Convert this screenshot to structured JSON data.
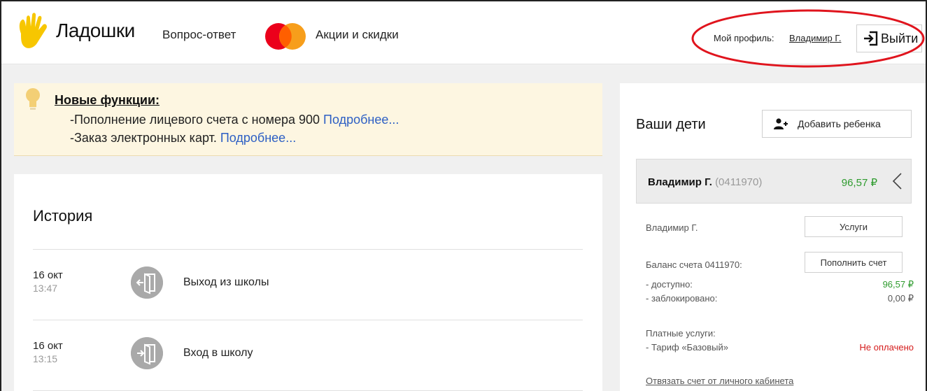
{
  "header": {
    "brand": "Ладошки",
    "nav_faq": "Вопрос-ответ",
    "nav_promo": "Акции и скидки",
    "profile_label": "Мой профиль:",
    "profile_name": "Владимир Г.",
    "logout_label": "Выйти"
  },
  "notice": {
    "title": "Новые функции:",
    "lines": [
      {
        "text": "-Пополнение лицевого счета с номера 900",
        "link": "Подробнее..."
      },
      {
        "text": "-Заказ электронных карт.",
        "link": "Подробнее..."
      }
    ]
  },
  "history": {
    "title": "История",
    "events": [
      {
        "date": "16 окт",
        "time": "13:47",
        "label": "Выход из школы",
        "icon": "school-exit-icon"
      },
      {
        "date": "16 окт",
        "time": "13:15",
        "label": "Вход в школу",
        "icon": "school-enter-icon"
      }
    ]
  },
  "kids": {
    "title": "Ваши дети",
    "add_child_label": "Добавить ребенка",
    "child": {
      "name": "Владимир Г.",
      "account_id": "(0411970)",
      "balance": "96,57 ₽",
      "short_name": "Владимир Г.",
      "services_button": "Услуги",
      "balance_label": "Баланс счета 0411970:",
      "topup_button": "Пополнить счет",
      "available_label": "- доступно:",
      "available_value": "96,57 ₽",
      "blocked_label": "- заблокировано:",
      "blocked_value": "0,00 ₽",
      "paid_services_label": "Платные услуги:",
      "tariff_label": "- Тариф «Базовый»",
      "tariff_status": "Не оплачено",
      "unlink_label": "Отвязать счет от личного кабинета"
    }
  },
  "colors": {
    "accent_yellow": "#f7c600",
    "link_blue": "#2d5fc4",
    "positive_green": "#2e9b2e",
    "negative_red": "#d51b1b",
    "highlight_red": "#e0141d"
  }
}
